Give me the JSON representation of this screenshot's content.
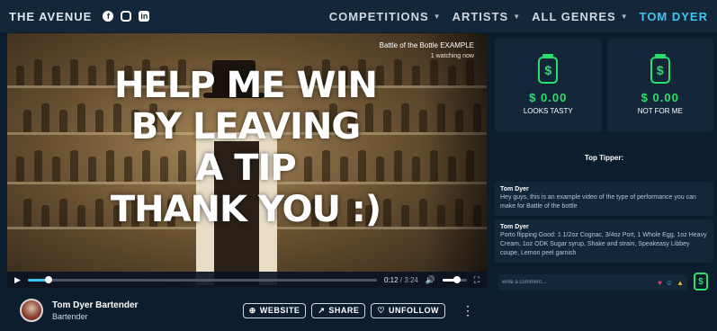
{
  "header": {
    "brand": "THE AVENUE",
    "social": [
      "facebook-icon",
      "instagram-icon",
      "linkedin-icon"
    ],
    "nav": [
      {
        "label": "COMPETITIONS"
      },
      {
        "label": "ARTISTS"
      },
      {
        "label": "ALL GENRES"
      }
    ],
    "user": "TOM DYER"
  },
  "video": {
    "overlay_lines": [
      "HELP ME WIN",
      "BY LEAVING",
      "A TIP",
      "THANK YOU :)"
    ],
    "title": "Battle of the Bottle EXAMPLE",
    "watching": "1 watching now",
    "current_time": "0:12",
    "duration": "3:24",
    "progress": 0.059,
    "volume": 0.6
  },
  "channel": {
    "name": "Tom Dyer Bartender",
    "role": "Bartender",
    "website_label": "WEBSITE",
    "share_label": "SHARE",
    "unfollow_label": "UNFOLLOW"
  },
  "sidebar": {
    "jars": [
      {
        "amount": "$ 0.00",
        "label": "LOOKS TASTY"
      },
      {
        "amount": "$ 0.00",
        "label": "NOT FOR ME"
      }
    ],
    "top_tipper_title": "Top Tipper:",
    "comments": [
      {
        "name": "Tom Dyer",
        "text": "Hey guys, this is an example video of the type of performance you can make for Battle of the bottle"
      },
      {
        "name": "Tom Dyer",
        "text": "Porto flipping Good: 1 1/2oz Cognac, 3/4oz Port, 1 Whole Egg, 1oz Heavy Cream, 1oz ODK Sugar syrup, Shake and strain, Speakeasy Libbey coupe, Lemon peel garnish"
      }
    ],
    "comment_placeholder": "write a comment..."
  },
  "colors": {
    "accent": "#3fc6f0",
    "money": "#2be06a",
    "panel": "#14263a",
    "background": "#0c1d2e"
  }
}
